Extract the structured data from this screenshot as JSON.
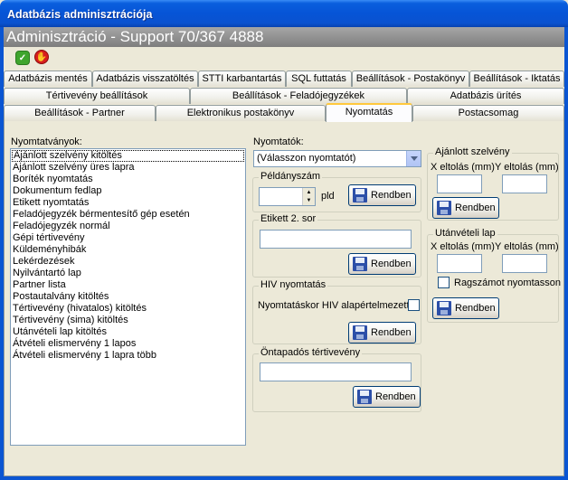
{
  "window": {
    "title": "Adatbázis adminisztrációja"
  },
  "header": {
    "text": "Adminisztráció - Support 70/367 4888"
  },
  "toolbar": {
    "ok_icon": "green-check-icon",
    "exit_icon": "red-stop-hand-icon"
  },
  "tabs": {
    "row1": [
      "Adatbázis mentés",
      "Adatbázis visszatöltés",
      "STTI karbantartás",
      "SQL futtatás",
      "Beállítások - Postakönyv",
      "Beállítások - Iktatás"
    ],
    "row2": [
      "Tértivevény beállítások",
      "Beállítások - Feladójegyzékek",
      "Adatbázis ürítés"
    ],
    "row3": [
      "Beállítások - Partner",
      "Elektronikus postakönyv",
      "Nyomtatás",
      "Postacsomag"
    ],
    "active": "Nyomtatás"
  },
  "forms": {
    "label": "Nyomtatványok:",
    "items": [
      "Ajánlott szelvény kitöltés",
      "Ajánlott szelvény üres lapra",
      "Boríték nyomtatás",
      "Dokumentum fedlap",
      "Etikett nyomtatás",
      "Feladójegyzék bérmentesítő gép esetén",
      "Feladójegyzék normál",
      "Gépi tértivevény",
      "Küldeményhibák",
      "Lekérdezések",
      "Nyilvántartó lap",
      "Partner lista",
      "Postautalvány kitöltés",
      "Tértivevény (hivatalos) kitöltés",
      "Tértivevény (sima) kitöltés",
      "Utánvételi lap kitöltés",
      "Átvételi elismervény 1 lapos",
      "Átvételi elismervény 1 lapra több"
    ],
    "selected_index": 0
  },
  "printers": {
    "label": "Nyomtatók:",
    "selected": "(Válasszon nyomtatót)"
  },
  "copies": {
    "title": "Példányszám",
    "value": "",
    "unit": "pld",
    "save": "Rendben"
  },
  "label2": {
    "title": "Etikett 2. sor",
    "value": "",
    "save": "Rendben"
  },
  "hiv": {
    "title": "HIV nyomtatás",
    "checkbox_label": "Nyomtatáskor HIV alapértelmezett",
    "checked": false,
    "save": "Rendben"
  },
  "selfadhesive": {
    "title": "Öntapadós tértivevény",
    "value": "",
    "save": "Rendben"
  },
  "registered": {
    "title": "Ajánlott szelvény",
    "x_label": "X eltolás (mm)",
    "y_label": "Y eltolás (mm)",
    "x_value": "",
    "y_value": "",
    "save": "Rendben"
  },
  "cod": {
    "title": "Utánvételi lap",
    "x_label": "X eltolás (mm)",
    "y_label": "Y eltolás (mm)",
    "x_value": "",
    "y_value": "",
    "checkbox_label": "Ragszámot nyomtasson",
    "checked": false,
    "save": "Rendben"
  },
  "colors": {
    "title_bar": "#0654D6",
    "header_band": "#8E8E8E",
    "active_tab_accent": "#FFC83C",
    "window_bg": "#ECE9D8"
  }
}
